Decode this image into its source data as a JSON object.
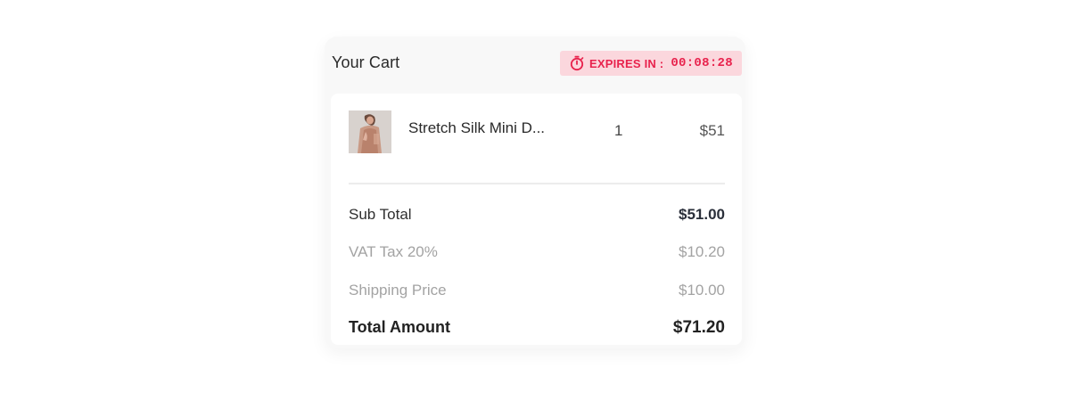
{
  "cart": {
    "title": "Your Cart",
    "timer": {
      "icon": "stopwatch-icon",
      "label": "EXPIRES IN :",
      "time": "00:08:28",
      "color": "#e8234d",
      "background": "#fbd7dd"
    }
  },
  "items": [
    {
      "thumbnail_icon": "product-thumbnail",
      "name": "Stretch Silk Mini D...",
      "quantity": "1",
      "price": "$51"
    }
  ],
  "summary": {
    "subtotal": {
      "label": "Sub Total",
      "value": "$51.00"
    },
    "vat": {
      "label": "VAT Tax 20%",
      "value": "$10.20"
    },
    "shipping": {
      "label": "Shipping Price",
      "value": "$10.00"
    },
    "total": {
      "label": "Total Amount",
      "value": "$71.20"
    }
  }
}
